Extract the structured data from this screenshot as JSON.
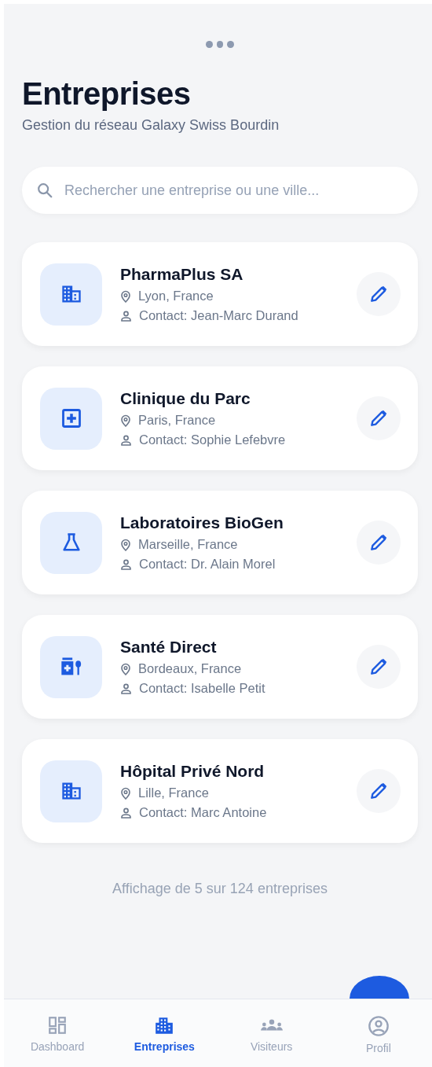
{
  "header": {
    "title": "Entreprises",
    "subtitle": "Gestion du réseau Galaxy Swiss Bourdin"
  },
  "search": {
    "placeholder": "Rechercher une entreprise ou une ville..."
  },
  "companies": [
    {
      "kind": "building",
      "name": "PharmaPlus SA",
      "location": "Lyon, France",
      "contact": "Contact: Jean-Marc Durand"
    },
    {
      "kind": "clinic",
      "name": "Clinique du Parc",
      "location": "Paris, France",
      "contact": "Contact: Sophie Lefebvre"
    },
    {
      "kind": "lab",
      "name": "Laboratoires BioGen",
      "location": "Marseille, France",
      "contact": "Contact: Dr. Alain Morel"
    },
    {
      "kind": "medication",
      "name": "Santé Direct",
      "location": "Bordeaux, France",
      "contact": "Contact: Isabelle Petit"
    },
    {
      "kind": "building",
      "name": "Hôpital Privé Nord",
      "location": "Lille, France",
      "contact": "Contact: Marc Antoine"
    }
  ],
  "footer": "Affichage de 5 sur 124 entreprises",
  "nav": [
    {
      "kind": "dashboard",
      "label": "Dashboard",
      "selected": false
    },
    {
      "kind": "companies",
      "label": "Entreprises",
      "selected": true
    },
    {
      "kind": "visitors",
      "label": "Visiteurs",
      "selected": false
    },
    {
      "kind": "profile",
      "label": "Profil",
      "selected": false
    }
  ]
}
